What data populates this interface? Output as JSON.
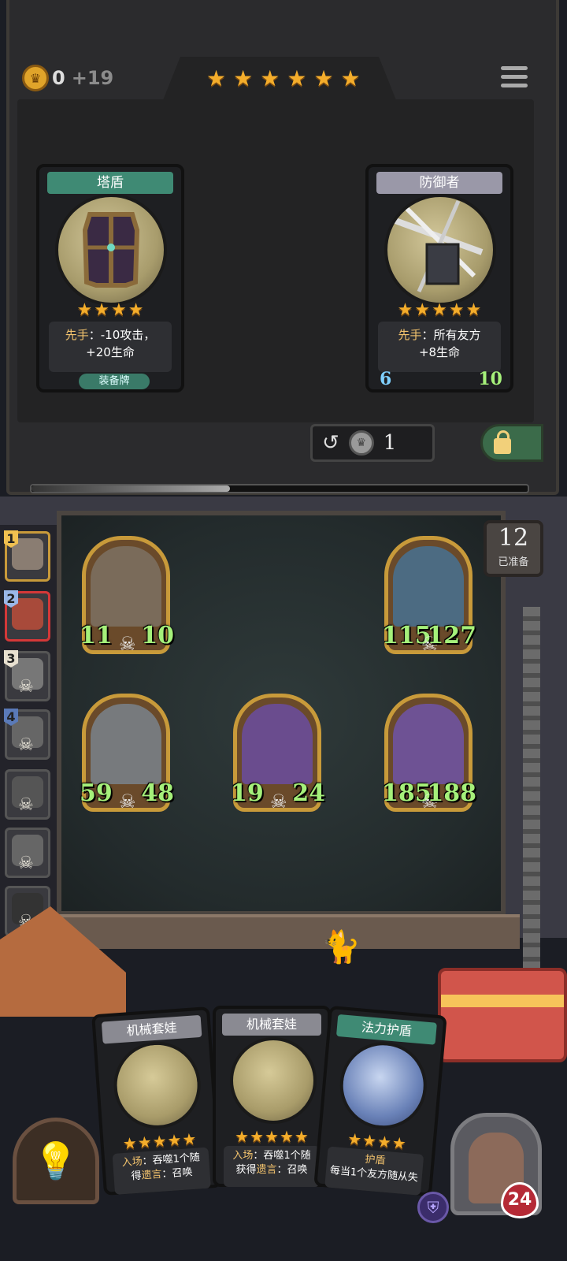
{
  "gold": {
    "amount": "0",
    "income": "+19"
  },
  "tavern": {
    "tier_stars": 6
  },
  "shop_cards": [
    {
      "name": "塔盾",
      "stars": 4,
      "desc_keyword": "先手",
      "desc_line1": "：-10攻击，",
      "desc_line2": "+20生命",
      "tag": "装备牌",
      "bar_color": "#3f8a74"
    },
    {
      "name": "防御者",
      "stars": 5,
      "desc_keyword": "先手",
      "desc_line1": "：所有友方",
      "desc_line2": "+8生命",
      "attack": "6",
      "health": "10",
      "bar_color": "#9a98a8"
    }
  ],
  "refresh": {
    "cost": "1"
  },
  "ready": {
    "count": "12",
    "label": "已准备"
  },
  "board_minions": [
    {
      "attack": "11",
      "health": "10",
      "art": "#7a6b5a"
    },
    {
      "attack": "115",
      "health": "127",
      "art": "#4c6b82"
    },
    {
      "attack": "59",
      "health": "48",
      "art": "#777a7d"
    },
    {
      "attack": "19",
      "health": "24",
      "art": "#6a4c8e"
    },
    {
      "attack": "185",
      "health": "188",
      "art": "#6e5294"
    }
  ],
  "heroes": [
    {
      "place": "1"
    },
    {
      "place": "2"
    },
    {
      "place": "3"
    },
    {
      "place": "4"
    },
    {
      "place": ""
    },
    {
      "place": ""
    },
    {
      "place": ""
    },
    {
      "place": ""
    }
  ],
  "hand_cards": [
    {
      "name": "机械套娃",
      "stars": 5,
      "line1_kw": "入场",
      "line1": "：吞噬1个随",
      "line2a": "得",
      "line2_kw": "遗言",
      "line2b": "：召唤",
      "bar_color": "#8a8a92"
    },
    {
      "name": "机械套娃",
      "stars": 5,
      "line1_kw": "入场",
      "line1": "：吞噬1个随",
      "line2a": "获得",
      "line2_kw": "遗言",
      "line2b": "：召唤",
      "bar_color": "#8a8a92"
    },
    {
      "name": "法力护盾",
      "stars": 4,
      "line1_kw": "护盾",
      "line1": "",
      "line2a": "每当1个友方随从失",
      "line2_kw": "",
      "line2b": "",
      "bar_color": "#3f8a74"
    }
  ],
  "player": {
    "health": "24"
  },
  "colors": {
    "gold_star": "#f4ad2b",
    "stat_green": "#a5f07a"
  }
}
